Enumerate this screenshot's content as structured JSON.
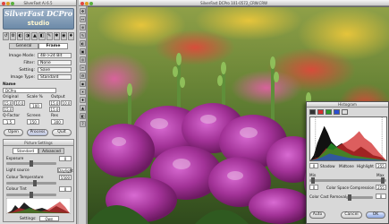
{
  "palette": {
    "title": "SilverFast Ai 6.5",
    "logo_line1": "SilverFast DCPro",
    "logo_line2": "studio",
    "tools": [
      "↺",
      "⚙",
      "◐",
      "◑",
      "▲",
      "◧",
      "✎",
      "✱",
      "◉",
      "♦"
    ],
    "tabs": [
      "General",
      "Frame"
    ],
    "fields": [
      {
        "label": "Image Mode:",
        "value": "48->24 Bit"
      },
      {
        "label": "Filter:",
        "value": "None"
      },
      {
        "label": "Setting:",
        "value": "Save"
      },
      {
        "label": "Image Type:",
        "value": "Standard"
      }
    ],
    "name_label": "Name",
    "name_value": "DCPro",
    "original_label": "Original",
    "scale_label": "Scale %",
    "output_label": "Output",
    "orig_w": "15.0",
    "orig_h": "10.0",
    "scale": "100",
    "out_w": "15.0",
    "out_h": "10.0",
    "q_factor_label": "Q-Factor",
    "q_factor": "1.5",
    "screen_label": "Screen",
    "screen": "150",
    "res_label": "Res",
    "res": "300",
    "buttons": {
      "open": "Open",
      "process": "Process",
      "quit": "Quit"
    }
  },
  "picture_settings": {
    "title": "Picture Settings",
    "tabs": [
      "Standard",
      "Advanced"
    ],
    "rows": [
      {
        "label": "Exposure",
        "value": "0"
      },
      {
        "label": "Light source",
        "value": "Daylight"
      },
      {
        "label": "Colour Temperature",
        "value": "5500"
      },
      {
        "label": "Colour Tint",
        "value": "0"
      }
    ],
    "settings_label": "Settings:",
    "settings_value": "Own"
  },
  "main": {
    "title": "SilverFast DCPro 101-0572_CRW.CRW",
    "side_tools": [
      "✥",
      "↔",
      "⊕",
      "✎",
      "◐",
      "▣",
      "◎",
      "✂",
      "⚙",
      "◉",
      "☀",
      "♦",
      "▲",
      "◧",
      "?"
    ]
  },
  "histogram": {
    "title": "Histogram",
    "channel_colors": [
      "#333333",
      "#d23030",
      "#2a9a2a",
      "#2a4fd2",
      "#dddddd"
    ],
    "shadow_label": "Shadow",
    "shadow_value": "0",
    "midtone_label": "Midtone",
    "highlight_label": "Highlight",
    "highlight_value": "255",
    "min_label": "Min",
    "min_value": "0",
    "max_label": "Max",
    "max_value": "255",
    "ccs_label": "Color Space Compression",
    "ccr_label": "Color Cast Removal",
    "ccr_value": "0",
    "auto_label": "Auto",
    "cancel_label": "Cancel",
    "ok_label": "OK"
  },
  "colors": {
    "flower_magenta": "#9b2a8c",
    "foliage": "#3c6a2a",
    "accent_yellow": "#e3b524"
  }
}
